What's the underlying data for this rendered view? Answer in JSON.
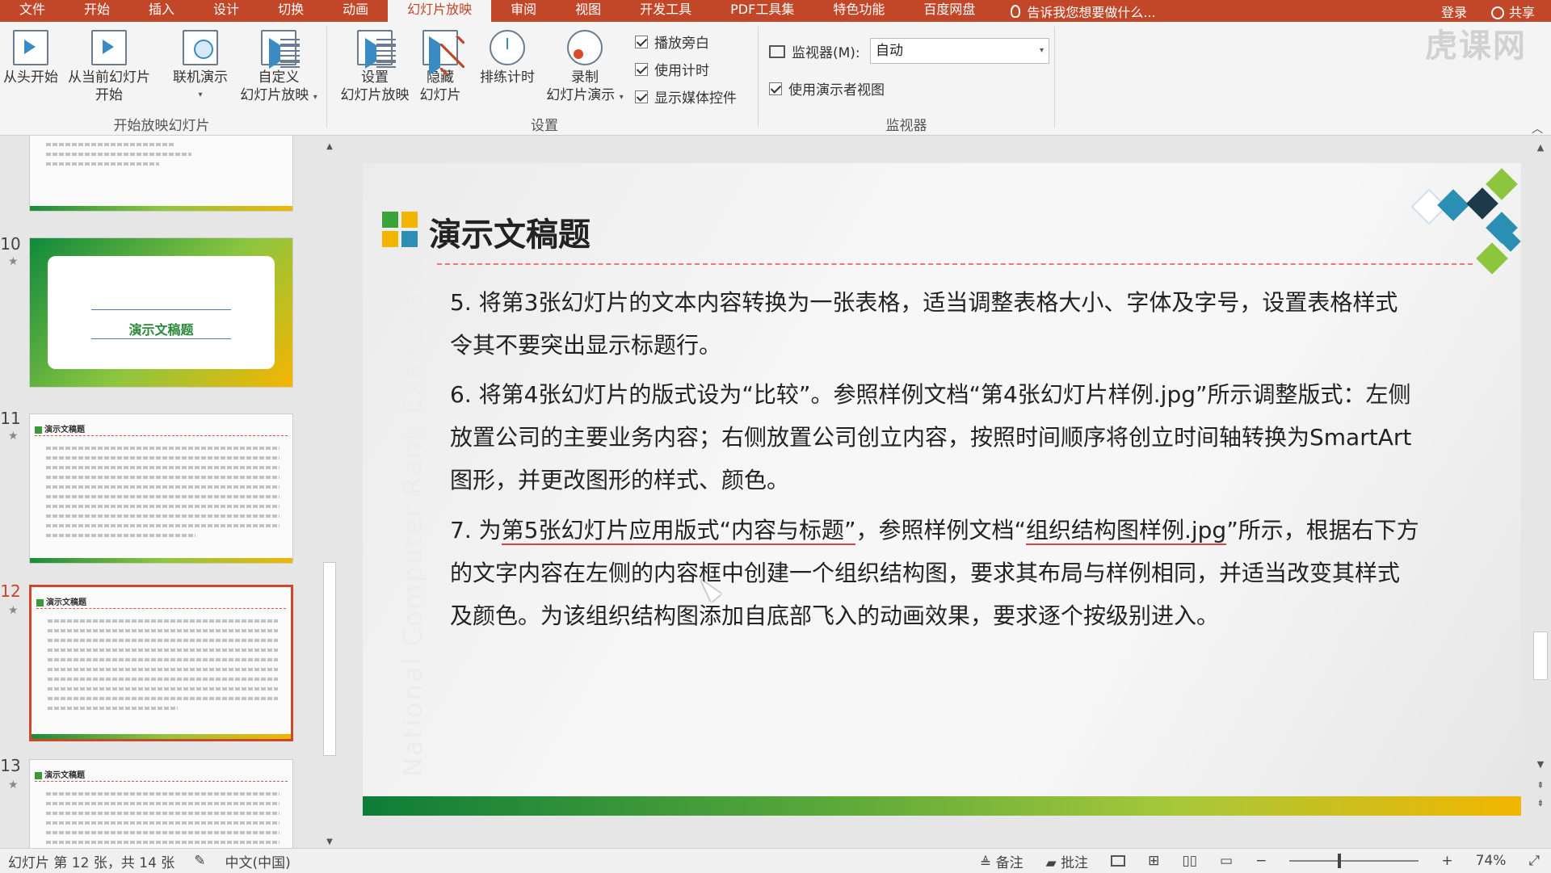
{
  "tabs": [
    {
      "label": "文件",
      "active": false
    },
    {
      "label": "开始",
      "active": false
    },
    {
      "label": "插入",
      "active": false
    },
    {
      "label": "设计",
      "active": false
    },
    {
      "label": "切换",
      "active": false
    },
    {
      "label": "动画",
      "active": false
    },
    {
      "label": "幻灯片放映",
      "active": true
    },
    {
      "label": "审阅",
      "active": false
    },
    {
      "label": "视图",
      "active": false
    },
    {
      "label": "开发工具",
      "active": false
    },
    {
      "label": "PDF工具集",
      "active": false
    },
    {
      "label": "特色功能",
      "active": false
    },
    {
      "label": "百度网盘",
      "active": false
    }
  ],
  "tellme": "告诉我您想要做什么...",
  "login": "登录",
  "share": "共享",
  "ribbon": {
    "from_start": "从头开始",
    "from_current_1": "从当前幻灯片",
    "from_current_2": "开始",
    "online_present": "联机演示",
    "custom_1": "自定义",
    "custom_2": "幻灯片放映",
    "group_start": "开始放映幻灯片",
    "setup_1": "设置",
    "setup_2": "幻灯片放映",
    "hide_1": "隐藏",
    "hide_2": "幻灯片",
    "rehearse": "排练计时",
    "record_1": "录制",
    "record_2": "幻灯片演示",
    "chk_narration": "播放旁白",
    "chk_timings": "使用计时",
    "chk_media": "显示媒体控件",
    "group_setup": "设置",
    "monitor_label": "监视器(M):",
    "monitor_value": "自动",
    "chk_presenter": "使用演示者视图",
    "group_monitor": "监视器"
  },
  "logo_text": "虎课网",
  "thumbnails": [
    {
      "num": "",
      "selected": false
    },
    {
      "num": "10",
      "selected": false,
      "title": "演示文稿题"
    },
    {
      "num": "11",
      "selected": false,
      "title": "演示文稿题"
    },
    {
      "num": "12",
      "selected": true,
      "title": "演示文稿题"
    },
    {
      "num": "13",
      "selected": false,
      "title": "演示文稿题"
    }
  ],
  "slide": {
    "title": "演示文稿题",
    "watermark": "National Computer Rank Examination",
    "item5_line1": "5. 将第3张幻灯片的文本内容转换为一张表格，适当调整表格大小、字体及字号，设置表格样式",
    "item5_line2": "令其不要突出显示标题行。",
    "item6_line1": "6. 将第4张幻灯片的版式设为“比较”。参照样例文档“第4张幻灯片样例.jpg”所示调整版式：左侧",
    "item6_line2": "放置公司的主要业务内容；右侧放置公司创立内容，按照时间顺序将创立时间轴转换为SmartArt",
    "item6_line3": "图形，并更改图形的样式、颜色。",
    "item7_pre": "7. 为",
    "item7_u1": "第5张幻灯片应用版式“内容与标题”",
    "item7_mid": "，参照样例文档“",
    "item7_u2": "组织结构图样例.jpg",
    "item7_post": "”所示，根据右下方",
    "item7_line2": "的文字内容在左侧的内容框中创建一个组织结构图，要求其布局与样例相同，并适当改变其样式",
    "item7_line3": "及颜色。为该组织结构图添加自底部飞入的动画效果，要求逐个按级别进入。"
  },
  "status": {
    "slide_info": "幻灯片 第 12 张，共 14 张",
    "language": "中文(中国)",
    "notes": "备注",
    "comments": "批注",
    "zoom": "74%"
  },
  "colors": {
    "accent": "#c24628",
    "green": "#1a8c3a",
    "yellow": "#f2b600"
  }
}
